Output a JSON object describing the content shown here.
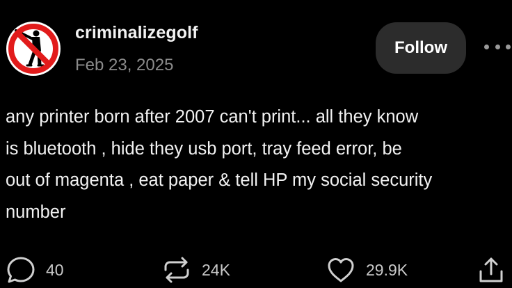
{
  "post": {
    "username": "criminalizegolf",
    "date": "Feb 23, 2025",
    "follow_label": "Follow",
    "text": "any printer born after 2007 can't print... all they know\nis bluetooth ,  hide they usb port, tray feed error, be\nout of magenta , eat paper & tell HP my social security\nnumber",
    "avatar_icon": "no-golf-icon",
    "avatar_colors": {
      "ring": "#e21b1b",
      "figure": "#000000",
      "background": "#ffffff"
    }
  },
  "actions": {
    "replies": "40",
    "reposts": "24K",
    "likes": "29.9K"
  },
  "icons": {
    "reply": "speech-bubble-icon",
    "repost": "repost-arrows-icon",
    "like": "heart-icon",
    "share": "share-icon",
    "more": "more-dots-icon"
  }
}
